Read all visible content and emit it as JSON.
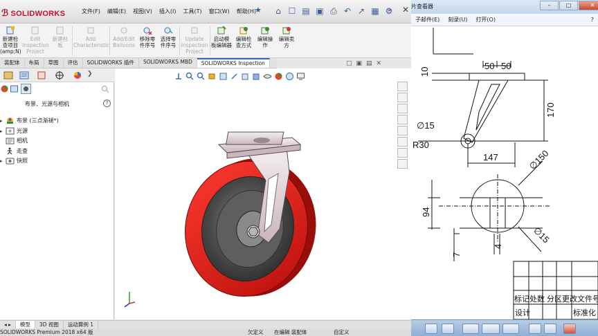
{
  "solidworks": {
    "logo": "SOLIDWORKS",
    "menu": [
      "文件(F)",
      "编辑(E)",
      "视图(V)",
      "插入(I)",
      "工具(T)",
      "窗口(W)",
      "帮助(H)"
    ],
    "ribbon": [
      {
        "label": "新建检\n查项目\n(amp;N)",
        "enabled": true
      },
      {
        "label": "Edit\nInspection\nProject",
        "enabled": false
      },
      {
        "label": "新建检\n板",
        "enabled": false
      },
      {
        "label": "Add\nCharacteristic",
        "enabled": false
      },
      {
        "label": "Add/Edit\nBalloons",
        "enabled": false
      },
      {
        "label": "移除零\n件序号",
        "enabled": true
      },
      {
        "label": "选择零\n件序号",
        "enabled": true
      },
      {
        "label": "Update\nInspection\nProject",
        "enabled": false
      },
      {
        "label": "启动模\n板编辑器",
        "enabled": true
      },
      {
        "label": "编辑检\n查方式",
        "enabled": true
      },
      {
        "label": "编辑操\n作",
        "enabled": true
      },
      {
        "label": "编辑卖\n方",
        "enabled": true
      }
    ],
    "command_tabs": [
      "装配体",
      "布局",
      "草图",
      "评估",
      "SOLIDWORKS 插件",
      "SOLIDWORKS MBD",
      "SOLIDWORKS Inspection"
    ],
    "active_command_tab": "SOLIDWORKS Inspection",
    "panel_title": "布景、光源与相机",
    "tree": [
      {
        "label": "布景 (三点渐褪*)",
        "icon": "scene-icon"
      },
      {
        "label": "光源",
        "icon": "light-icon"
      },
      {
        "label": "相机",
        "icon": "camera-icon"
      },
      {
        "label": "走查",
        "icon": "walkthrough-icon"
      },
      {
        "label": "快照",
        "icon": "snapshot-icon"
      }
    ],
    "bottom_tabs": [
      "模型",
      "3D 视图",
      "运动算例 1"
    ],
    "active_bottom_tab": "模型",
    "status": {
      "version": "SOLIDWORKS Premium 2018 x64 版",
      "field1": "欠定义",
      "field2": "在编辑 装配体",
      "field3": "自定义"
    }
  },
  "viewer": {
    "title": "片查看器",
    "menu": [
      "子邮件(E)",
      "刻录(U)",
      "打开(O)"
    ],
    "drawing": {
      "dims": {
        "d10": "10",
        "d50a": "50",
        "d50b": "50",
        "phi15a": "∅15",
        "d170": "170",
        "r30": "R30",
        "d147": "147",
        "phi150": "∅150",
        "d94": "94",
        "phi15b": "∅15",
        "d7": "7",
        "d4": "4"
      },
      "table": {
        "row1": "标记处数 分区更改文件号",
        "design": "设计",
        "std": "标准化"
      }
    }
  }
}
